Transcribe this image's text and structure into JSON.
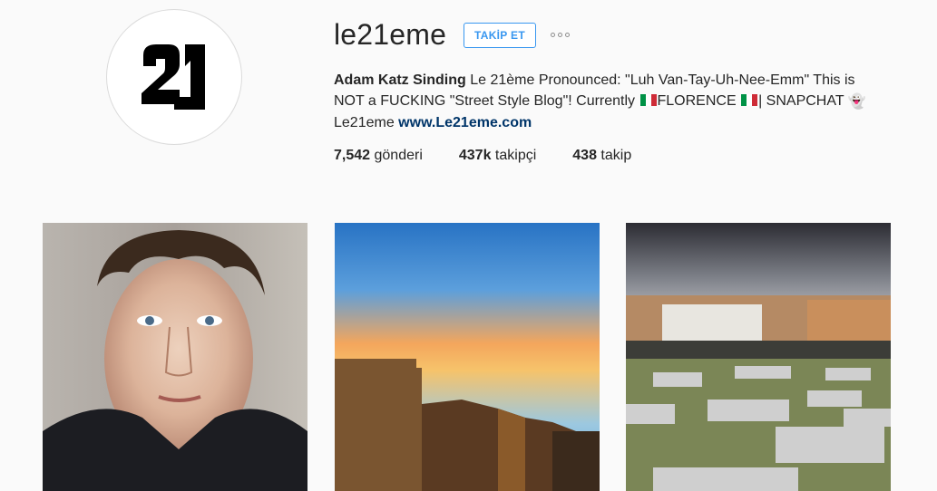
{
  "profile": {
    "username": "le21eme",
    "avatar_logo_text": "21",
    "follow_label": "TAKİP ET",
    "more_icon": "ellipsis-icon",
    "bio": {
      "full_name": "Adam Katz Sinding",
      "text_1": " Le 21ème Pronounced: \"Luh Van-Tay-Uh-Nee-Emm\" This is NOT a FUCKING \"Street Style Blog\"! Currently ",
      "text_2": "FLORENCE ",
      "text_3": "| SNAPCHAT ",
      "ghost_glyph": "👻",
      "text_4": " Le21eme ",
      "link": "www.Le21eme.com"
    },
    "flag_colors": [
      "#009246",
      "#ffffff",
      "#ce2b37"
    ],
    "stats": {
      "posts_count": "7,542",
      "posts_label": " gönderi",
      "followers_count": "437k",
      "followers_label": " takipçi",
      "following_count": "438",
      "following_label": " takip"
    }
  },
  "colors": {
    "accent": "#3897f0",
    "link": "#003569",
    "text": "#262626",
    "background": "#fafafa"
  },
  "posts": [
    {
      "subject": "portrait-photo"
    },
    {
      "subject": "sunset-building-photo"
    },
    {
      "subject": "eyes-installation-photo"
    }
  ]
}
